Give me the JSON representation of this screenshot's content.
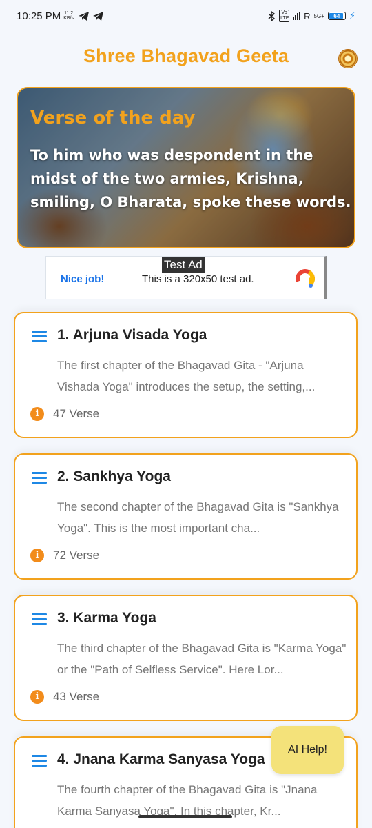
{
  "status_bar": {
    "time": "10:25 PM",
    "speed_value": "11.2",
    "speed_unit": "KB/s",
    "vo_lte": "Vo LTE",
    "roaming": "R",
    "network": "5G+",
    "battery": "64"
  },
  "header": {
    "title": "Shree Bhagavad Geeta",
    "logo_icon": "chakra-logo-icon"
  },
  "verse_of_day": {
    "label": "Verse of the day",
    "text": "To him who was despondent in the midst of the two armies, Krishna, smiling, O Bharata, spoke these words."
  },
  "ad": {
    "badge": "Test Ad",
    "cta": "Nice job!",
    "text": "This is a 320x50 test ad."
  },
  "chapters": [
    {
      "title": "1. Arjuna Visada Yoga",
      "description": "The first chapter of the Bhagavad Gita - \"Arjuna Vishada Yoga\" introduces the setup, the setting,...",
      "verses": "47 Verse"
    },
    {
      "title": "2. Sankhya Yoga",
      "description": "The second chapter of the Bhagavad Gita is \"Sankhya Yoga\". This is the most important cha...",
      "verses": "72 Verse"
    },
    {
      "title": "3. Karma Yoga",
      "description": "The third chapter of the Bhagavad Gita is \"Karma Yoga\" or the \"Path of Selfless Service\". Here Lor...",
      "verses": "43 Verse"
    },
    {
      "title": "4. Jnana Karma Sanyasa Yoga",
      "description": "The fourth chapter of the Bhagavad Gita is \"Jnana Karma Sanyasa Yoga\". In this chapter, Kr...",
      "verses": ""
    }
  ],
  "ai_help": {
    "label": "AI Help!"
  },
  "colors": {
    "accent": "#f2a21d",
    "menu_icon": "#1e88e5",
    "info_icon": "#f28c1b",
    "ai_button": "#f4e27a"
  }
}
